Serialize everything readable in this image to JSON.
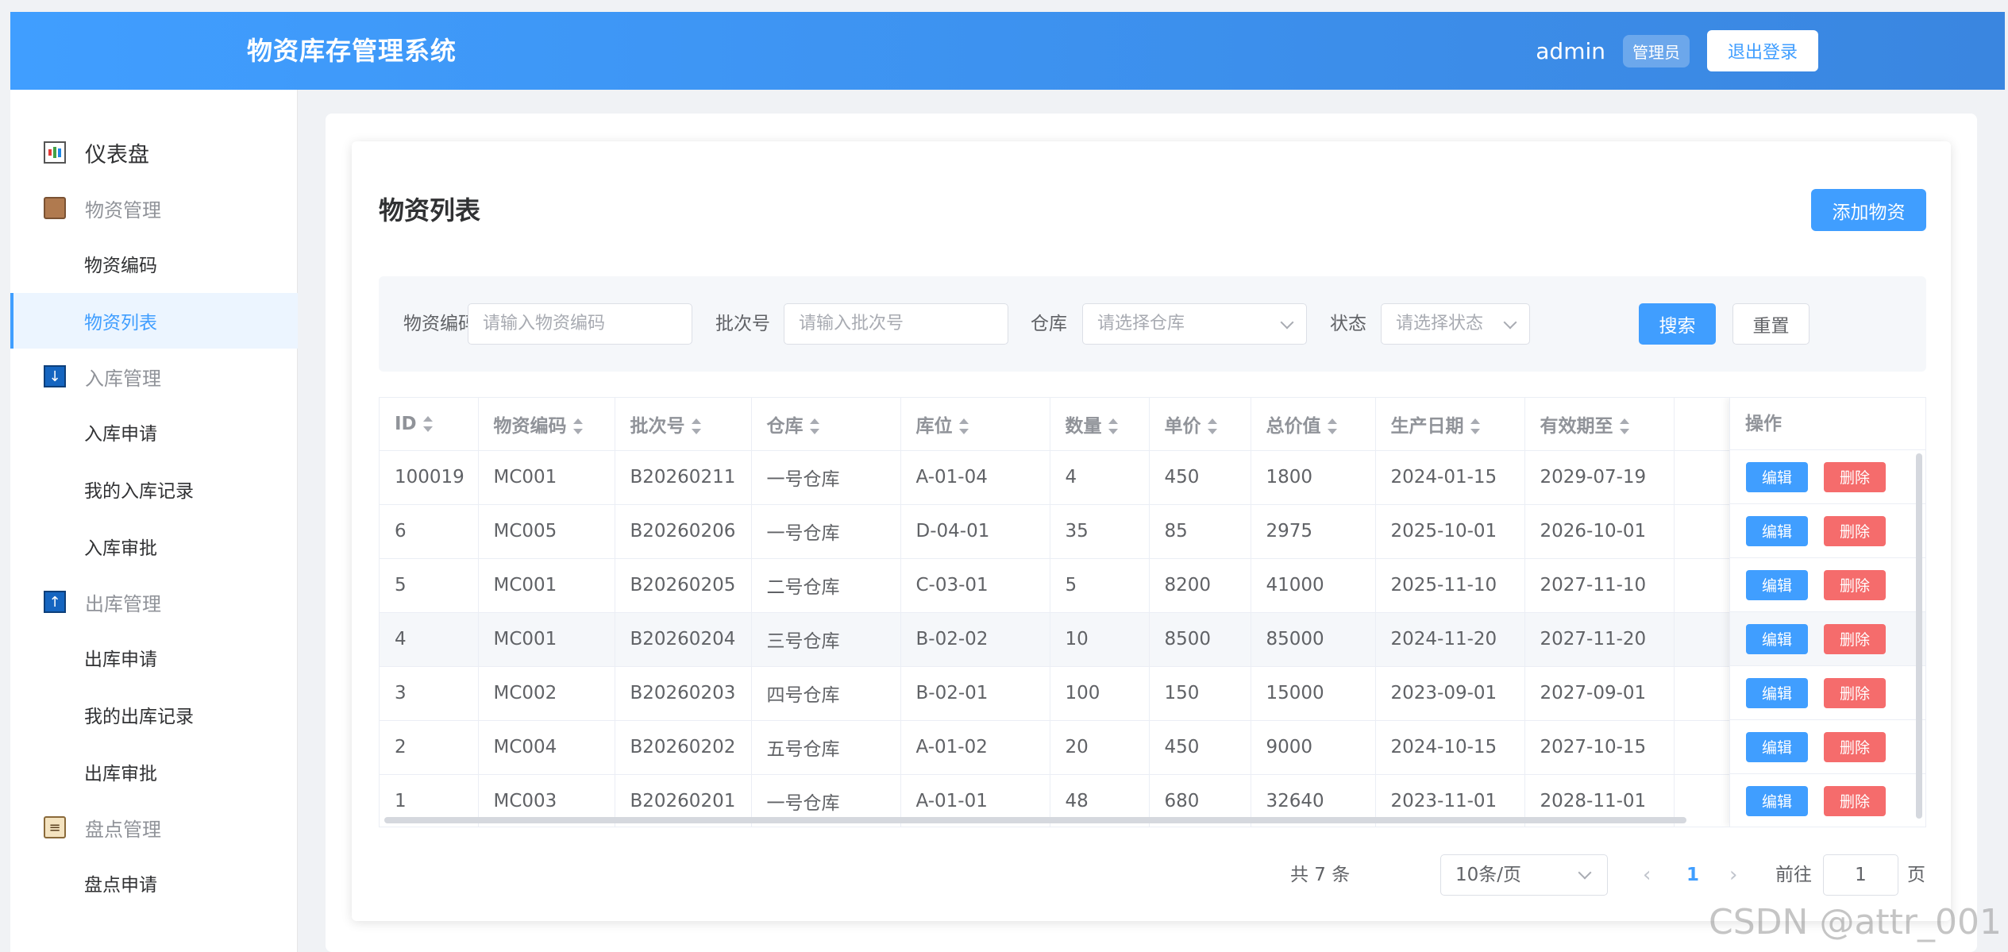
{
  "header": {
    "title": "物资库存管理系统",
    "username": "admin",
    "role": "管理员",
    "logout_label": "退出登录"
  },
  "sidebar": {
    "items": [
      {
        "label": "仪表盘",
        "icon": "dashboard-chart-icon",
        "kind": "top"
      },
      {
        "label": "物资管理",
        "icon": "package-box-icon",
        "kind": "group"
      },
      {
        "label": "物资编码",
        "kind": "sub"
      },
      {
        "label": "物资列表",
        "kind": "sub",
        "active": true
      },
      {
        "label": "入库管理",
        "icon": "inbound-arrow-icon",
        "kind": "group"
      },
      {
        "label": "入库申请",
        "kind": "sub"
      },
      {
        "label": "我的入库记录",
        "kind": "sub"
      },
      {
        "label": "入库审批",
        "kind": "sub"
      },
      {
        "label": "出库管理",
        "icon": "outbound-arrow-icon",
        "kind": "group"
      },
      {
        "label": "出库申请",
        "kind": "sub"
      },
      {
        "label": "我的出库记录",
        "kind": "sub"
      },
      {
        "label": "出库审批",
        "kind": "sub"
      },
      {
        "label": "盘点管理",
        "icon": "clipboard-icon",
        "kind": "group"
      },
      {
        "label": "盘点申请",
        "kind": "sub"
      }
    ]
  },
  "main": {
    "title": "物资列表",
    "add_label": "添加物资",
    "filters": {
      "code_label": "物资编码",
      "code_placeholder": "请输入物资编码",
      "batch_label": "批次号",
      "batch_placeholder": "请输入批次号",
      "warehouse_label": "仓库",
      "warehouse_placeholder": "请选择仓库",
      "status_label": "状态",
      "status_placeholder": "请选择状态",
      "search_label": "搜索",
      "reset_label": "重置"
    },
    "table": {
      "columns": [
        "ID",
        "物资编码",
        "批次号",
        "仓库",
        "库位",
        "数量",
        "单价",
        "总价值",
        "生产日期",
        "有效期至"
      ],
      "ops_header": "操作",
      "edit_label": "编辑",
      "delete_label": "删除",
      "rows": [
        [
          "100019",
          "MC001",
          "B20260211",
          "一号仓库",
          "A-01-04",
          "4",
          "450",
          "1800",
          "2024-01-15",
          "2029-07-19"
        ],
        [
          "6",
          "MC005",
          "B20260206",
          "一号仓库",
          "D-04-01",
          "35",
          "85",
          "2975",
          "2025-10-01",
          "2026-10-01"
        ],
        [
          "5",
          "MC001",
          "B20260205",
          "二号仓库",
          "C-03-01",
          "5",
          "8200",
          "41000",
          "2025-11-10",
          "2027-11-10"
        ],
        [
          "4",
          "MC001",
          "B20260204",
          "三号仓库",
          "B-02-02",
          "10",
          "8500",
          "85000",
          "2024-11-20",
          "2027-11-20"
        ],
        [
          "3",
          "MC002",
          "B20260203",
          "四号仓库",
          "B-02-01",
          "100",
          "150",
          "15000",
          "2023-09-01",
          "2027-09-01"
        ],
        [
          "2",
          "MC004",
          "B20260202",
          "五号仓库",
          "A-01-02",
          "20",
          "450",
          "9000",
          "2024-10-15",
          "2027-10-15"
        ],
        [
          "1",
          "MC003",
          "B20260201",
          "一号仓库",
          "A-01-01",
          "48",
          "680",
          "32640",
          "2023-11-01",
          "2028-11-01"
        ]
      ],
      "highlight_row": 3
    },
    "pagination": {
      "total_text": "共 7 条",
      "page_size": "10条/页",
      "current_page": "1",
      "goto_label": "前往",
      "goto_value": "1",
      "page_suffix": "页",
      "prev": "‹",
      "next": "›"
    }
  },
  "watermark": "CSDN @attr_001"
}
